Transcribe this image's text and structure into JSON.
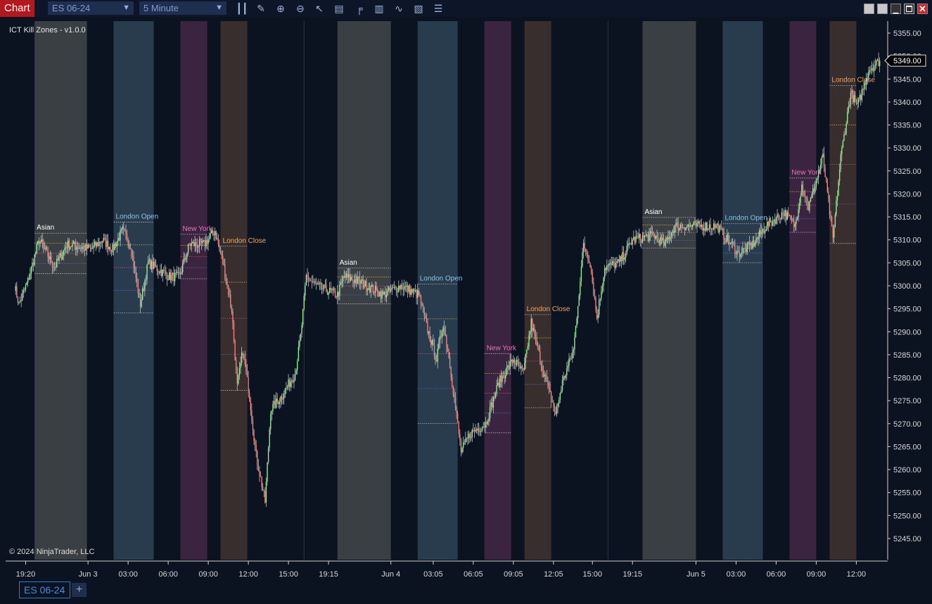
{
  "toolbar": {
    "title": "Chart",
    "instrument": "ES 06-24",
    "interval": "5 Minute",
    "tools": [
      "bar-style-icon",
      "pencil-icon",
      "zoom-in-icon",
      "zoom-out-icon",
      "pointer-icon",
      "data-box-icon",
      "chart-trader-icon",
      "strategies-icon",
      "indicators-icon",
      "properties-icon",
      "list-icon"
    ]
  },
  "window_buttons": [
    "tile-icon",
    "tile-icon",
    "minimize-icon",
    "maximize-icon",
    "close-icon"
  ],
  "indicator_label": "ICT Kill Zones - v1.0.0",
  "copyright": "© 2024 NinjaTrader, LLC",
  "bottom_tabs": {
    "active": "ES 06-24",
    "add": "+"
  },
  "colors": {
    "background": "#0b1321",
    "up": "#90ee90",
    "down": "#ff7b7b",
    "asian": "#3a3f43",
    "london_open": "#283c4d",
    "new_york": "#3b2440",
    "london_close": "#392e2e",
    "asian_label": "#ffffff",
    "london_open_label": "#86c5e6",
    "new_york_label": "#e874b4",
    "london_close_label": "#f0a45c"
  },
  "chart_data": {
    "type": "candlestick",
    "x_unit": "bar index (5 minute bars)",
    "ylim": [
      5242,
      5358
    ],
    "y_ticks": [
      5355,
      5350,
      5345,
      5340,
      5335,
      5330,
      5325,
      5320,
      5315,
      5310,
      5305,
      5300,
      5295,
      5290,
      5285,
      5280,
      5275,
      5270,
      5265,
      5260,
      5255,
      5250,
      5245
    ],
    "y_tick_labels": [
      "5355.00",
      "5350.00",
      "5345.00",
      "5340.00",
      "5335.00",
      "5330.00",
      "5325.00",
      "5320.00",
      "5315.00",
      "5310.00",
      "5305.00",
      "5300.00",
      "5295.00",
      "5290.00",
      "5285.00",
      "5280.00",
      "5275.00",
      "5270.00",
      "5265.00",
      "5260.00",
      "5255.00",
      "5250.00",
      "5245.00"
    ],
    "last_price": "5349.00",
    "x_ticks": [
      {
        "bar": 18,
        "label": "19:20"
      },
      {
        "bar": 74,
        "label": "Jun 3"
      },
      {
        "bar": 110,
        "label": "03:00"
      },
      {
        "bar": 146,
        "label": "06:00"
      },
      {
        "bar": 182,
        "label": "09:00"
      },
      {
        "bar": 218,
        "label": "12:00"
      },
      {
        "bar": 254,
        "label": "15:00"
      },
      {
        "bar": 290,
        "label": "19:15"
      },
      {
        "bar": 346,
        "label": "Jun 4"
      },
      {
        "bar": 384,
        "label": "03:05"
      },
      {
        "bar": 420,
        "label": "06:05"
      },
      {
        "bar": 456,
        "label": "09:05"
      },
      {
        "bar": 492,
        "label": "12:05"
      },
      {
        "bar": 527,
        "label": "15:00"
      },
      {
        "bar": 563,
        "label": "19:15"
      },
      {
        "bar": 620,
        "label": "Jun 5"
      },
      {
        "bar": 656,
        "label": "03:00"
      },
      {
        "bar": 692,
        "label": "06:00"
      },
      {
        "bar": 728,
        "label": "09:00"
      },
      {
        "bar": 764,
        "label": "12:00"
      }
    ],
    "session_breaks": [
      268,
      541
    ],
    "zones": [
      {
        "label": "Asian",
        "kind": "asian",
        "start": 26,
        "end": 73
      },
      {
        "label": "London Open",
        "kind": "london_open",
        "start": 97,
        "end": 133
      },
      {
        "label": "New York",
        "kind": "new_york",
        "start": 157,
        "end": 181
      },
      {
        "label": "London Close",
        "kind": "london_close",
        "start": 193,
        "end": 217
      },
      {
        "label": "Asian",
        "kind": "asian",
        "start": 298,
        "end": 346
      },
      {
        "label": "London Open",
        "kind": "london_open",
        "start": 370,
        "end": 406
      },
      {
        "label": "New York",
        "kind": "new_york",
        "start": 430,
        "end": 454
      },
      {
        "label": "London Close",
        "kind": "london_close",
        "start": 466,
        "end": 490
      },
      {
        "label": "Asian",
        "kind": "asian",
        "start": 572,
        "end": 620
      },
      {
        "label": "London Open",
        "kind": "london_open",
        "start": 644,
        "end": 680
      },
      {
        "label": "New York",
        "kind": "new_york",
        "start": 704,
        "end": 728
      },
      {
        "label": "London Close",
        "kind": "london_close",
        "start": 740,
        "end": 764
      }
    ],
    "price_path": [
      [
        8,
        5300
      ],
      [
        12,
        5296
      ],
      [
        20,
        5301
      ],
      [
        30,
        5310
      ],
      [
        44,
        5304
      ],
      [
        55,
        5309
      ],
      [
        77,
        5308
      ],
      [
        87,
        5310
      ],
      [
        96,
        5308
      ],
      [
        105,
        5312
      ],
      [
        112,
        5309
      ],
      [
        121,
        5296
      ],
      [
        128,
        5305
      ],
      [
        147,
        5302
      ],
      [
        156,
        5302
      ],
      [
        165,
        5309
      ],
      [
        178,
        5309
      ],
      [
        188,
        5312
      ],
      [
        196,
        5304
      ],
      [
        203,
        5295
      ],
      [
        208,
        5278
      ],
      [
        213,
        5286
      ],
      [
        219,
        5276
      ],
      [
        225,
        5263
      ],
      [
        233,
        5253
      ],
      [
        238,
        5273
      ],
      [
        248,
        5276
      ],
      [
        260,
        5281
      ],
      [
        265,
        5289
      ],
      [
        270,
        5302
      ],
      [
        279,
        5300
      ],
      [
        298,
        5298
      ],
      [
        304,
        5302
      ],
      [
        317,
        5301
      ],
      [
        339,
        5298
      ],
      [
        355,
        5300
      ],
      [
        371,
        5298
      ],
      [
        377,
        5292
      ],
      [
        387,
        5284
      ],
      [
        393,
        5292
      ],
      [
        399,
        5283
      ],
      [
        409,
        5264
      ],
      [
        418,
        5268
      ],
      [
        431,
        5270
      ],
      [
        443,
        5279
      ],
      [
        456,
        5284
      ],
      [
        465,
        5281
      ],
      [
        472,
        5292
      ],
      [
        481,
        5283
      ],
      [
        494,
        5272
      ],
      [
        500,
        5279
      ],
      [
        510,
        5286
      ],
      [
        519,
        5309
      ],
      [
        525,
        5305
      ],
      [
        531,
        5293
      ],
      [
        538,
        5304
      ],
      [
        551,
        5305
      ],
      [
        563,
        5310
      ],
      [
        582,
        5311
      ],
      [
        592,
        5309
      ],
      [
        601,
        5313
      ],
      [
        620,
        5313
      ],
      [
        639,
        5313
      ],
      [
        658,
        5307
      ],
      [
        671,
        5309
      ],
      [
        683,
        5313
      ],
      [
        699,
        5316
      ],
      [
        709,
        5313
      ],
      [
        715,
        5322
      ],
      [
        721,
        5317
      ],
      [
        734,
        5328
      ],
      [
        743,
        5310
      ],
      [
        750,
        5328
      ],
      [
        759,
        5342
      ],
      [
        765,
        5339
      ],
      [
        775,
        5347
      ],
      [
        785,
        5349
      ]
    ]
  }
}
